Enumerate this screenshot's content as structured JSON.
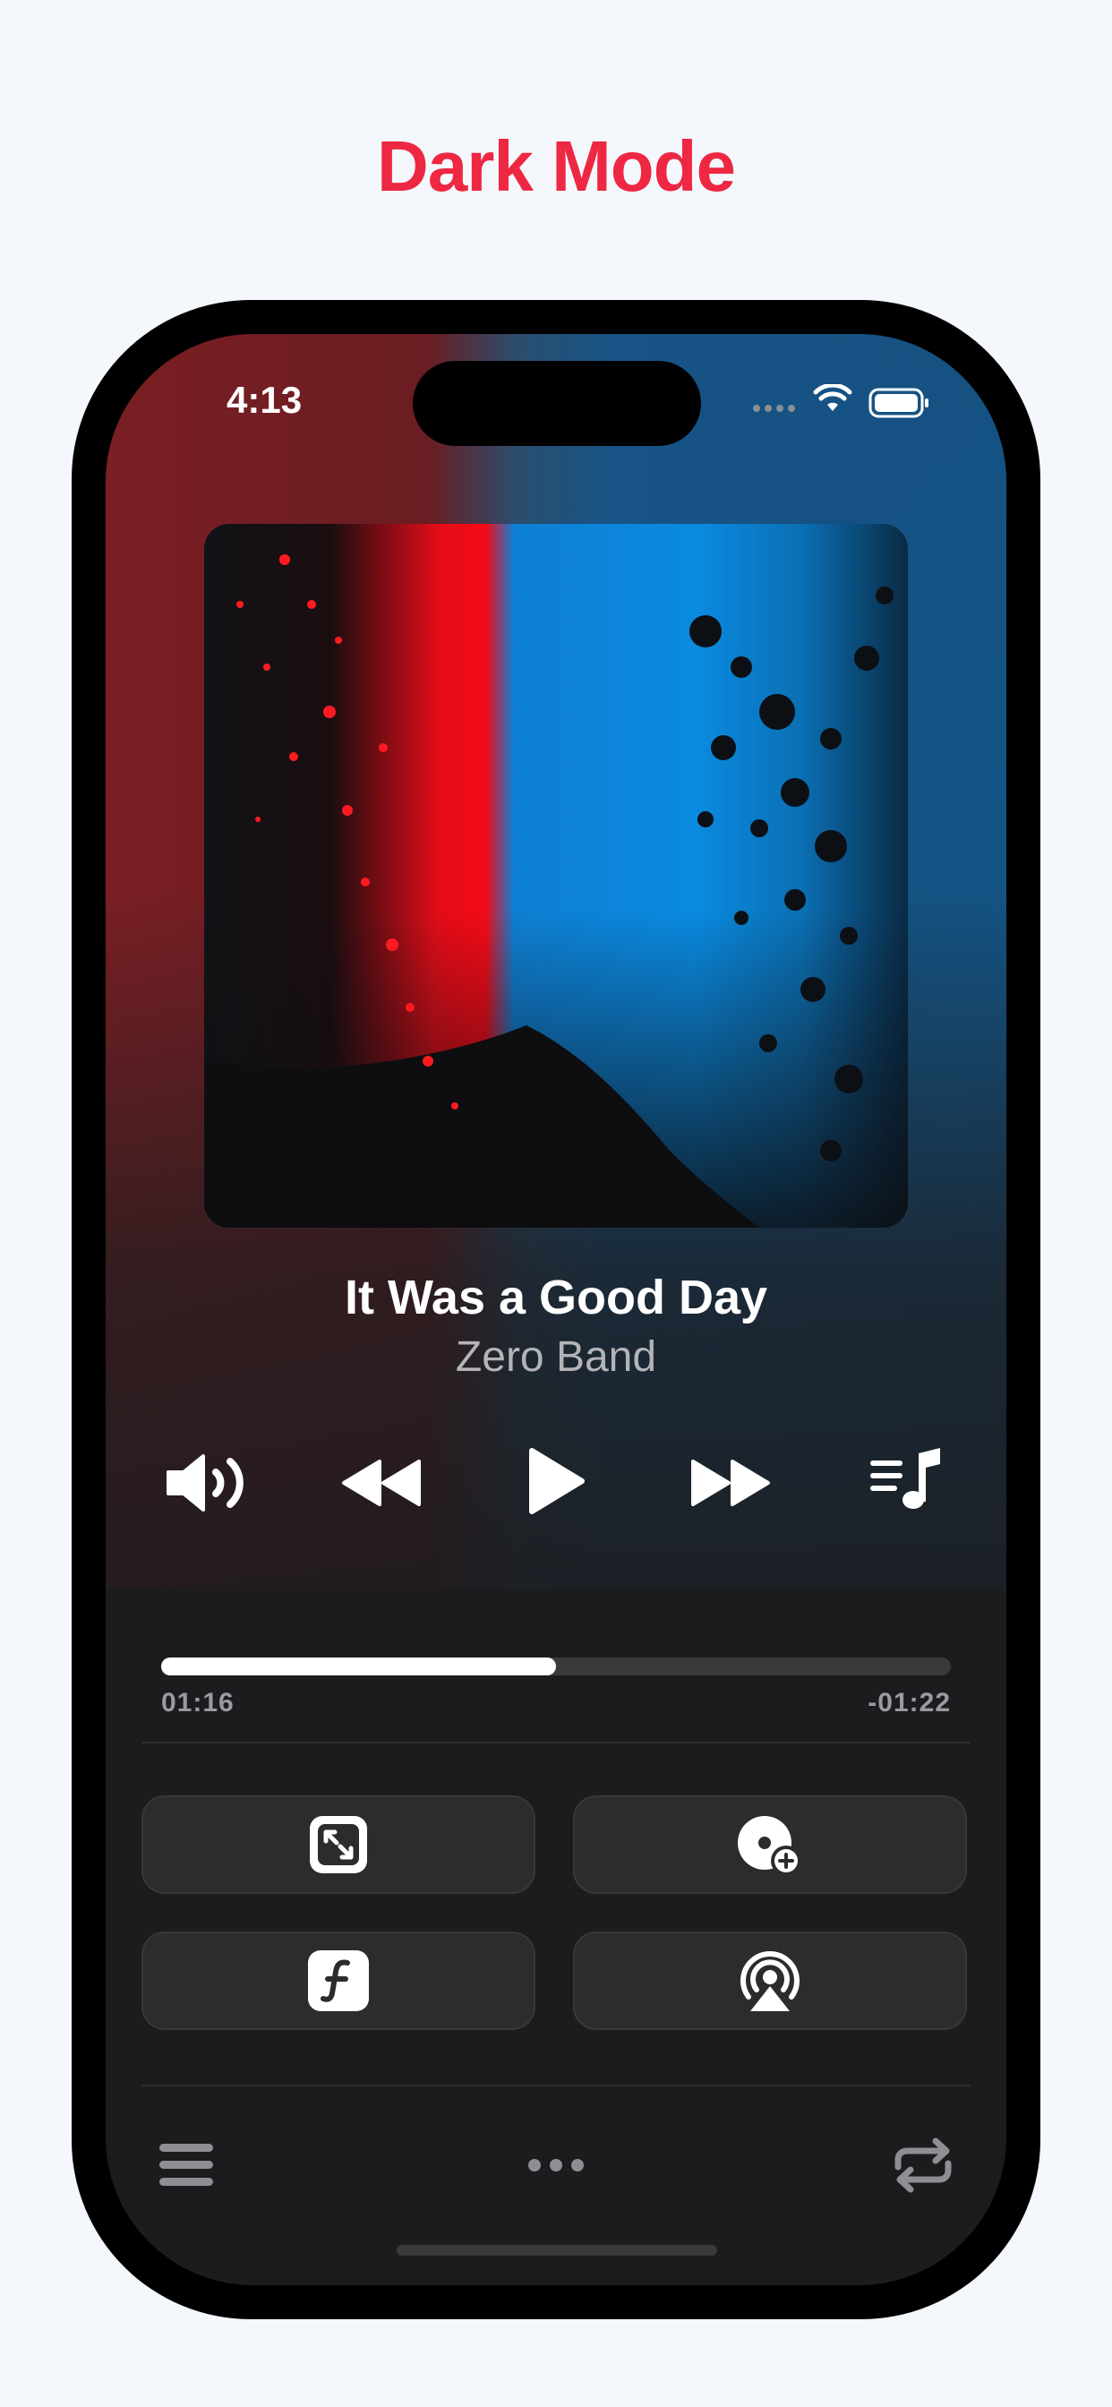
{
  "header": {
    "headline": "Dark Mode"
  },
  "status_bar": {
    "time": "4:13"
  },
  "now_playing": {
    "title": "It Was a Good Day",
    "artist": "Zero Band",
    "elapsed": "01:16",
    "remaining": "-01:22",
    "progress_fraction": 0.5
  },
  "controls": {
    "volume": "speaker-icon",
    "previous": "rewind-icon",
    "play": "play-icon",
    "next": "fast-forward-icon",
    "queue": "music-queue-icon"
  },
  "tiles": [
    "fullscreen-icon",
    "add-to-library-icon",
    "font-icon",
    "airplay-icon"
  ],
  "bottom_bar": [
    "menu-icon",
    "more-icon",
    "repeat-icon"
  ],
  "colors": {
    "accent": "#ee2742",
    "background": "#f4f7fc",
    "panel": "#1c1c1e",
    "tile": "#2c2c2e"
  }
}
